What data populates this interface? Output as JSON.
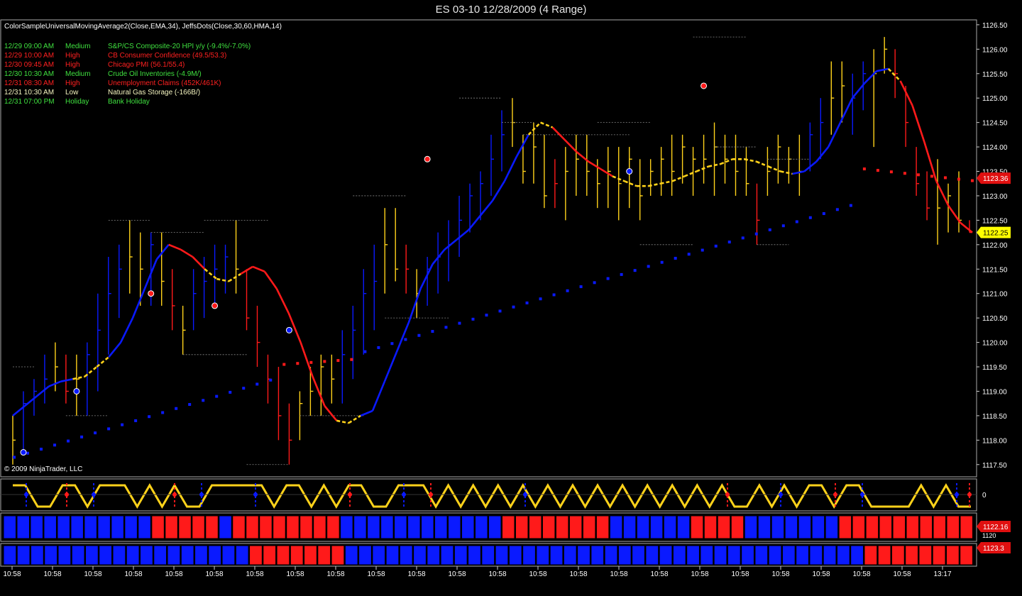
{
  "window": {
    "title": "ES 03-10  12/28/2009 (4 Range)"
  },
  "indicator_label": "ColorSampleUniversalMovingAverage2(Close,EMA,34),  JeffsDots(Close,30,60,HMA,14)",
  "copyright": "© 2009 NinjaTrader, LLC",
  "colors": {
    "background": "#000000",
    "blue": "#0a1aff",
    "red": "#ff1a1a",
    "yellow": "#ffd21a",
    "green": "#3fe03f",
    "olive": "#e0e0a0"
  },
  "events": [
    {
      "time": "12/29 09:00 AM",
      "impact": "Medium",
      "desc": "S&P/CS Composite-20 HPI y/y (-9.4%/-7.0%)",
      "color": "#3fe03f"
    },
    {
      "time": "12/29 10:00 AM",
      "impact": "High",
      "desc": "CB Consumer Confidence (49.5/53.3)",
      "color": "#ff2020"
    },
    {
      "time": "12/30 09:45 AM",
      "impact": "High",
      "desc": "Chicago PMI (56.1/55.4)",
      "color": "#ff2020"
    },
    {
      "time": "12/30 10:30 AM",
      "impact": "Medium",
      "desc": "Crude Oil Inventories (-4.9M/)",
      "color": "#3fe03f"
    },
    {
      "time": "12/31 08:30 AM",
      "impact": "High",
      "desc": "Unemployment Claims (452K/461K)",
      "color": "#ff2020"
    },
    {
      "time": "12/31 10:30 AM",
      "impact": "Low",
      "desc": "Natural Gas Storage (-166B/)",
      "color": "#f5f5c0"
    },
    {
      "time": "12/31 07:00 PM",
      "impact": "Holiday",
      "desc": "Bank Holiday",
      "color": "#3fe03f"
    }
  ],
  "chart_data": {
    "type": "line",
    "title": "ES 03-10  12/28/2009 (4 Range)",
    "ylim": [
      1117.25,
      1126.6
    ],
    "y_ticks": [
      "1126.50",
      "1126.00",
      "1125.50",
      "1125.00",
      "1124.50",
      "1124.00",
      "1123.50",
      "1123.00",
      "1122.50",
      "1122.00",
      "1121.50",
      "1121.00",
      "1120.50",
      "1120.00",
      "1119.50",
      "1119.00",
      "1118.50",
      "1118.00",
      "1117.50"
    ],
    "x_ticks": [
      "10:58",
      "10:58",
      "10:58",
      "10:58",
      "10:58",
      "10:58",
      "10:58",
      "10:58",
      "10:58",
      "10:58",
      "10:58",
      "10:58",
      "10:58",
      "10:58",
      "10:58",
      "10:58",
      "10:58",
      "10:58",
      "10:58",
      "10:58",
      "10:58",
      "10:58",
      "10:58",
      "13:17"
    ],
    "price_bars": [
      {
        "h": 1118.5,
        "l": 1117.5,
        "c": 1118.0,
        "col": "y"
      },
      {
        "h": 1119.0,
        "l": 1117.75,
        "c": 1118.75,
        "col": "b"
      },
      {
        "h": 1119.25,
        "l": 1118.5,
        "c": 1119.0,
        "col": "b"
      },
      {
        "h": 1119.75,
        "l": 1118.75,
        "c": 1119.25,
        "col": "b"
      },
      {
        "h": 1120.0,
        "l": 1119.0,
        "c": 1119.5,
        "col": "y"
      },
      {
        "h": 1119.75,
        "l": 1118.75,
        "c": 1119.0,
        "col": "r"
      },
      {
        "h": 1119.75,
        "l": 1118.5,
        "c": 1119.25,
        "col": "y"
      },
      {
        "h": 1120.0,
        "l": 1118.5,
        "c": 1119.75,
        "col": "b"
      },
      {
        "h": 1121.0,
        "l": 1119.0,
        "c": 1120.25,
        "col": "b"
      },
      {
        "h": 1121.75,
        "l": 1119.75,
        "c": 1121.0,
        "col": "b"
      },
      {
        "h": 1122.0,
        "l": 1120.5,
        "c": 1121.5,
        "col": "b"
      },
      {
        "h": 1122.5,
        "l": 1121.0,
        "c": 1121.75,
        "col": "y"
      },
      {
        "h": 1122.25,
        "l": 1120.75,
        "c": 1121.5,
        "col": "y"
      },
      {
        "h": 1122.25,
        "l": 1120.75,
        "c": 1122.0,
        "col": "b"
      },
      {
        "h": 1122.25,
        "l": 1120.75,
        "c": 1121.25,
        "col": "y"
      },
      {
        "h": 1121.5,
        "l": 1120.25,
        "c": 1120.75,
        "col": "r"
      },
      {
        "h": 1120.75,
        "l": 1119.75,
        "c": 1120.25,
        "col": "y"
      },
      {
        "h": 1121.5,
        "l": 1120.25,
        "c": 1121.0,
        "col": "b"
      },
      {
        "h": 1121.75,
        "l": 1120.5,
        "c": 1121.25,
        "col": "b"
      },
      {
        "h": 1122.0,
        "l": 1120.75,
        "c": 1121.5,
        "col": "b"
      },
      {
        "h": 1122.0,
        "l": 1121.0,
        "c": 1121.75,
        "col": "b"
      },
      {
        "h": 1122.5,
        "l": 1121.0,
        "c": 1121.5,
        "col": "y"
      },
      {
        "h": 1121.5,
        "l": 1120.25,
        "c": 1120.5,
        "col": "r"
      },
      {
        "h": 1120.75,
        "l": 1119.5,
        "c": 1120.0,
        "col": "r"
      },
      {
        "h": 1119.75,
        "l": 1118.75,
        "c": 1119.25,
        "col": "r"
      },
      {
        "h": 1119.5,
        "l": 1118.0,
        "c": 1118.5,
        "col": "r"
      },
      {
        "h": 1118.75,
        "l": 1117.5,
        "c": 1118.0,
        "col": "r"
      },
      {
        "h": 1119.0,
        "l": 1118.0,
        "c": 1118.75,
        "col": "y"
      },
      {
        "h": 1119.5,
        "l": 1118.5,
        "c": 1119.0,
        "col": "y"
      },
      {
        "h": 1119.75,
        "l": 1118.5,
        "c": 1119.5,
        "col": "y"
      },
      {
        "h": 1119.75,
        "l": 1118.75,
        "c": 1119.25,
        "col": "y"
      },
      {
        "h": 1120.25,
        "l": 1118.75,
        "c": 1119.75,
        "col": "b"
      },
      {
        "h": 1120.75,
        "l": 1119.25,
        "c": 1120.25,
        "col": "b"
      },
      {
        "h": 1121.5,
        "l": 1119.75,
        "c": 1121.0,
        "col": "b"
      },
      {
        "h": 1122.0,
        "l": 1120.25,
        "c": 1121.25,
        "col": "b"
      },
      {
        "h": 1122.75,
        "l": 1121.0,
        "c": 1122.0,
        "col": "y"
      },
      {
        "h": 1122.75,
        "l": 1121.25,
        "c": 1121.5,
        "col": "y"
      },
      {
        "h": 1122.0,
        "l": 1121.0,
        "c": 1121.5,
        "col": "r"
      },
      {
        "h": 1121.5,
        "l": 1120.5,
        "c": 1121.0,
        "col": "y"
      },
      {
        "h": 1121.75,
        "l": 1120.75,
        "c": 1121.5,
        "col": "b"
      },
      {
        "h": 1122.25,
        "l": 1121.0,
        "c": 1121.75,
        "col": "b"
      },
      {
        "h": 1122.5,
        "l": 1121.25,
        "c": 1122.0,
        "col": "b"
      },
      {
        "h": 1123.0,
        "l": 1121.75,
        "c": 1122.5,
        "col": "b"
      },
      {
        "h": 1123.25,
        "l": 1122.25,
        "c": 1123.0,
        "col": "b"
      },
      {
        "h": 1123.5,
        "l": 1122.5,
        "c": 1123.25,
        "col": "b"
      },
      {
        "h": 1124.25,
        "l": 1123.0,
        "c": 1123.75,
        "col": "b"
      },
      {
        "h": 1124.75,
        "l": 1123.5,
        "c": 1124.25,
        "col": "b"
      },
      {
        "h": 1125.0,
        "l": 1124.0,
        "c": 1124.5,
        "col": "y"
      },
      {
        "h": 1124.25,
        "l": 1123.25,
        "c": 1123.5,
        "col": "y"
      },
      {
        "h": 1124.5,
        "l": 1123.25,
        "c": 1124.0,
        "col": "y"
      },
      {
        "h": 1124.25,
        "l": 1122.75,
        "c": 1123.0,
        "col": "y"
      },
      {
        "h": 1123.75,
        "l": 1122.75,
        "c": 1123.25,
        "col": "r"
      },
      {
        "h": 1124.0,
        "l": 1122.5,
        "c": 1123.5,
        "col": "y"
      },
      {
        "h": 1124.25,
        "l": 1123.0,
        "c": 1123.75,
        "col": "y"
      },
      {
        "h": 1124.25,
        "l": 1123.0,
        "c": 1123.5,
        "col": "y"
      },
      {
        "h": 1123.75,
        "l": 1122.75,
        "c": 1123.25,
        "col": "y"
      },
      {
        "h": 1124.0,
        "l": 1122.75,
        "c": 1123.5,
        "col": "y"
      },
      {
        "h": 1124.0,
        "l": 1122.5,
        "c": 1123.25,
        "col": "y"
      },
      {
        "h": 1124.0,
        "l": 1122.75,
        "c": 1123.75,
        "col": "y"
      },
      {
        "h": 1123.75,
        "l": 1122.5,
        "c": 1123.0,
        "col": "y"
      },
      {
        "h": 1123.75,
        "l": 1123.0,
        "c": 1123.5,
        "col": "y"
      },
      {
        "h": 1124.0,
        "l": 1123.0,
        "c": 1123.75,
        "col": "y"
      },
      {
        "h": 1124.25,
        "l": 1123.0,
        "c": 1123.5,
        "col": "y"
      },
      {
        "h": 1124.25,
        "l": 1123.25,
        "c": 1124.0,
        "col": "y"
      },
      {
        "h": 1124.0,
        "l": 1123.0,
        "c": 1123.75,
        "col": "y"
      },
      {
        "h": 1124.25,
        "l": 1123.25,
        "c": 1123.75,
        "col": "y"
      },
      {
        "h": 1124.5,
        "l": 1123.0,
        "c": 1124.0,
        "col": "y"
      },
      {
        "h": 1124.25,
        "l": 1123.25,
        "c": 1123.75,
        "col": "y"
      },
      {
        "h": 1124.25,
        "l": 1123.0,
        "c": 1123.5,
        "col": "y"
      },
      {
        "h": 1124.0,
        "l": 1123.0,
        "c": 1123.25,
        "col": "y"
      },
      {
        "h": 1123.25,
        "l": 1122.0,
        "c": 1122.5,
        "col": "r"
      },
      {
        "h": 1124.0,
        "l": 1123.0,
        "c": 1123.5,
        "col": "y"
      },
      {
        "h": 1124.25,
        "l": 1123.25,
        "c": 1124.0,
        "col": "y"
      },
      {
        "h": 1124.0,
        "l": 1123.25,
        "c": 1123.75,
        "col": "y"
      },
      {
        "h": 1124.25,
        "l": 1123.0,
        "c": 1123.5,
        "col": "y"
      },
      {
        "h": 1124.5,
        "l": 1123.5,
        "c": 1124.25,
        "col": "b"
      },
      {
        "h": 1125.0,
        "l": 1123.75,
        "c": 1124.5,
        "col": "b"
      },
      {
        "h": 1125.75,
        "l": 1124.25,
        "c": 1125.0,
        "col": "y"
      },
      {
        "h": 1125.75,
        "l": 1124.5,
        "c": 1125.25,
        "col": "y"
      },
      {
        "h": 1125.5,
        "l": 1124.25,
        "c": 1125.0,
        "col": "b"
      },
      {
        "h": 1125.75,
        "l": 1124.75,
        "c": 1125.5,
        "col": "b"
      },
      {
        "h": 1126.0,
        "l": 1124.0,
        "c": 1125.5,
        "col": "y"
      },
      {
        "h": 1126.25,
        "l": 1125.5,
        "c": 1126.0,
        "col": "y"
      },
      {
        "h": 1126.0,
        "l": 1125.0,
        "c": 1125.5,
        "col": "r"
      },
      {
        "h": 1125.25,
        "l": 1124.0,
        "c": 1124.5,
        "col": "r"
      },
      {
        "h": 1124.0,
        "l": 1123.0,
        "c": 1123.25,
        "col": "r"
      },
      {
        "h": 1123.5,
        "l": 1122.5,
        "c": 1122.75,
        "col": "r"
      },
      {
        "h": 1123.75,
        "l": 1122.0,
        "c": 1122.75,
        "col": "y"
      },
      {
        "h": 1123.25,
        "l": 1122.25,
        "c": 1123.0,
        "col": "y"
      },
      {
        "h": 1123.5,
        "l": 1122.25,
        "c": 1122.5,
        "col": "y"
      },
      {
        "h": 1122.5,
        "l": 1122.25,
        "c": 1122.25,
        "col": "r"
      }
    ],
    "ema_line": [
      1118.5,
      1118.7,
      1118.9,
      1119.1,
      1119.2,
      1119.25,
      1119.3,
      1119.5,
      1119.7,
      1120.0,
      1120.5,
      1121.1,
      1121.7,
      1122.0,
      1121.9,
      1121.75,
      1121.5,
      1121.3,
      1121.25,
      1121.4,
      1121.55,
      1121.45,
      1121.1,
      1120.6,
      1120.0,
      1119.3,
      1118.7,
      1118.4,
      1118.35,
      1118.5,
      1118.6,
      1119.2,
      1119.8,
      1120.4,
      1121.1,
      1121.6,
      1121.9,
      1122.1,
      1122.3,
      1122.6,
      1122.9,
      1123.3,
      1123.8,
      1124.25,
      1124.5,
      1124.4,
      1124.15,
      1123.9,
      1123.7,
      1123.55,
      1123.4,
      1123.3,
      1123.2,
      1123.2,
      1123.25,
      1123.3,
      1123.4,
      1123.5,
      1123.6,
      1123.65,
      1123.75,
      1123.75,
      1123.7,
      1123.6,
      1123.5,
      1123.45,
      1123.5,
      1123.7,
      1124.0,
      1124.5,
      1125.0,
      1125.3,
      1125.55,
      1125.6,
      1125.35,
      1124.85,
      1124.1,
      1123.3,
      1122.8,
      1122.45,
      1122.25
    ],
    "ema_colors": "bbbbbyyybbbbbrrryyyrrrrrrrryybbbbbbbbbbbbbbyyrrrrryyyyyyyyyyyyyyybbbbbbbbyrrrrrrr",
    "dots_line": {
      "start": 1117.65,
      "end": 1123.55,
      "red_from": 1119.55,
      "red_end": 1119.65
    },
    "circles": [
      {
        "i": 1,
        "v": 1117.75,
        "col": "b"
      },
      {
        "i": 6,
        "v": 1119.0,
        "col": "b"
      },
      {
        "i": 13,
        "v": 1121.0,
        "col": "r"
      },
      {
        "i": 19,
        "v": 1120.75,
        "col": "r"
      },
      {
        "i": 26,
        "v": 1120.25,
        "col": "b"
      },
      {
        "i": 39,
        "v": 1123.75,
        "col": "r"
      },
      {
        "i": 58,
        "v": 1123.5,
        "col": "b"
      },
      {
        "i": 65,
        "v": 1125.25,
        "col": "r"
      }
    ],
    "price_markers": [
      {
        "label": "1123.36",
        "v": 1123.36,
        "bg": "#e01010",
        "fg": "#ffffff"
      },
      {
        "label": "1122.25",
        "v": 1122.25,
        "bg": "#ffff00",
        "fg": "#000000"
      }
    ],
    "zigzag_panel": {
      "label": "0"
    },
    "blocks_panel_1": {
      "label_a": "1122.16",
      "label_b": "1120",
      "pattern": "bbbbbbbbbbbrrrrrbrrrrrrrrbbbbbbbbbbbbrrrrrrrrbbbbbbrrrrbbbbbbbrrrrrrrrrr"
    },
    "blocks_panel_2": {
      "label": "1123.3",
      "pattern": "bbbbbbbbbbbbbbbbbbrrrrrrrbbbbbbbbbbbbbbbbbbbbbbbbbbbbbbbbbbbbbbrrrrrrrr"
    }
  }
}
